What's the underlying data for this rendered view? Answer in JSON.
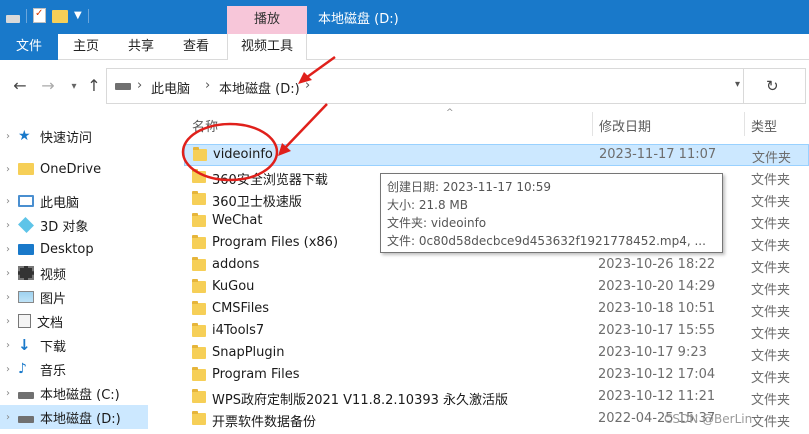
{
  "titlebar": {
    "context_tab": "播放",
    "window_title": "本地磁盘 (D:)"
  },
  "ribbon": {
    "file": "文件",
    "home": "主页",
    "share": "共享",
    "view": "查看",
    "video_tools": "视频工具"
  },
  "address": {
    "crumbs": [
      "此电脑",
      "本地磁盘 (D:)"
    ]
  },
  "sidebar": {
    "items": [
      {
        "label": "快速访问",
        "icon": "star-icon"
      },
      {
        "label": "OneDrive",
        "icon": "folder-icon"
      },
      {
        "label": "此电脑",
        "icon": "computer-icon"
      },
      {
        "label": "3D 对象",
        "icon": "cube-icon"
      },
      {
        "label": "Desktop",
        "icon": "desktop-icon"
      },
      {
        "label": "视频",
        "icon": "video-icon"
      },
      {
        "label": "图片",
        "icon": "pictures-icon"
      },
      {
        "label": "文档",
        "icon": "documents-icon"
      },
      {
        "label": "下载",
        "icon": "download-icon"
      },
      {
        "label": "音乐",
        "icon": "music-icon"
      },
      {
        "label": "本地磁盘 (C:)",
        "icon": "drive-icon"
      },
      {
        "label": "本地磁盘 (D:)",
        "icon": "drive-icon"
      }
    ]
  },
  "columns": {
    "name": "名称",
    "modified": "修改日期",
    "type": "类型"
  },
  "files": [
    {
      "name": "videoinfo",
      "date": "2023-11-17 11:07",
      "type": "文件夹"
    },
    {
      "name": "360安全浏览器下载",
      "date": "",
      "type": "文件夹"
    },
    {
      "name": "360卫士极速版",
      "date": "",
      "type": "文件夹"
    },
    {
      "name": "WeChat",
      "date": "",
      "type": "文件夹"
    },
    {
      "name": "Program Files (x86)",
      "date": "",
      "type": "文件夹"
    },
    {
      "name": "addons",
      "date": "2023-10-26 18:22",
      "type": "文件夹"
    },
    {
      "name": "KuGou",
      "date": "2023-10-20 14:29",
      "type": "文件夹"
    },
    {
      "name": "CMSFiles",
      "date": "2023-10-18 10:51",
      "type": "文件夹"
    },
    {
      "name": "i4Tools7",
      "date": "2023-10-17 15:55",
      "type": "文件夹"
    },
    {
      "name": "SnapPlugin",
      "date": "2023-10-17 9:23",
      "type": "文件夹"
    },
    {
      "name": "Program Files",
      "date": "2023-10-12 17:04",
      "type": "文件夹"
    },
    {
      "name": "WPS政府定制版2021 V11.8.2.10393 永久激活版",
      "date": "2023-10-12 11:21",
      "type": "文件夹"
    },
    {
      "name": "开票软件数据备份",
      "date": "2022-04-25 15:37",
      "type": "文件夹"
    }
  ],
  "tooltip": {
    "created": "创建日期: 2023-11-17 10:59",
    "size": "大小: 21.8 MB",
    "folders": "文件夹: videoinfo",
    "files": "文件: 0c80d58decbce9d453632f1921778452.mp4, ..."
  },
  "watermark": "CSDN @BerLin"
}
